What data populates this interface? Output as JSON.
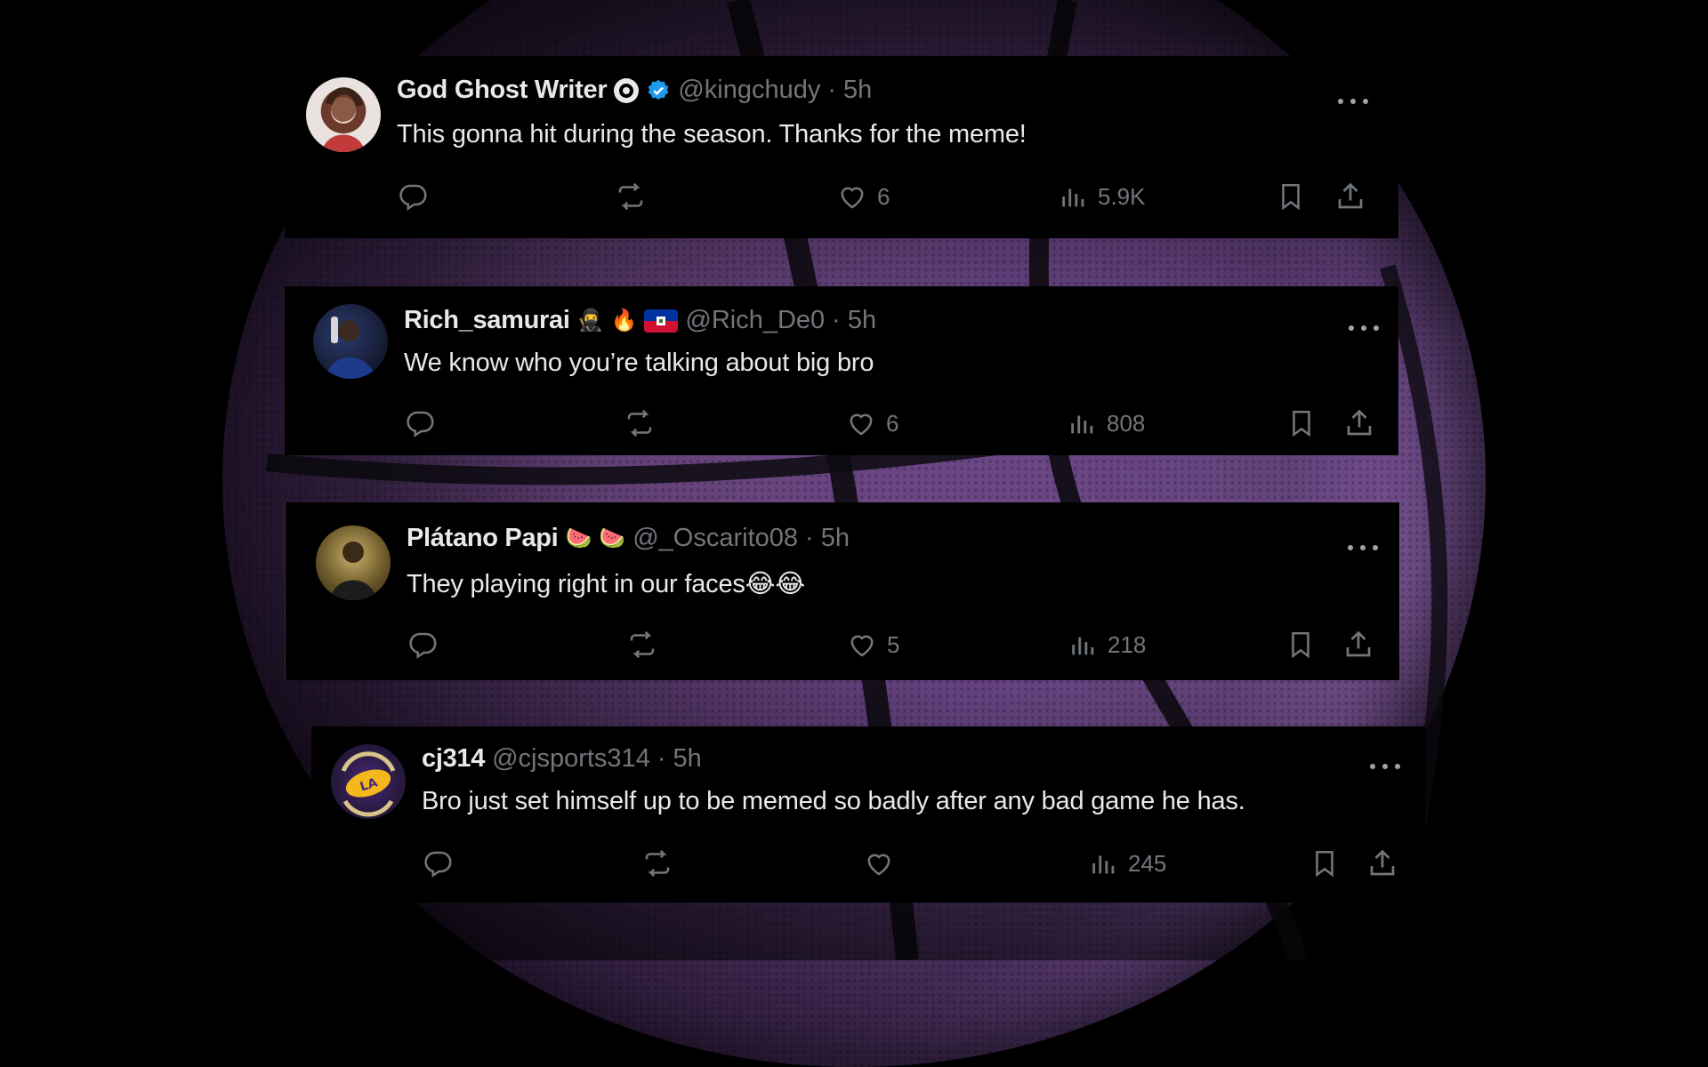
{
  "tweets": [
    {
      "name": "God Ghost Writer",
      "badge_icons": [
        "circle-badge-icon",
        "verified-badge-icon"
      ],
      "handle": "@kingchudy",
      "time": "5h",
      "text": "This gonna hit during the season. Thanks for the meme!",
      "likes": "6",
      "views": "5.9K"
    },
    {
      "name": "Rich_samurai",
      "name_emojis": [
        "🥷",
        "🔥"
      ],
      "flag_icon": "haiti-flag-icon",
      "handle": "@Rich_De0",
      "time": "5h",
      "text": "We know who you’re talking about big bro",
      "likes": "6",
      "views": "808"
    },
    {
      "name": "Plátano Papi",
      "name_emojis": [
        "🍉",
        "🍉"
      ],
      "handle": "@_Oscarito08",
      "time": "5h",
      "text": "They playing right in our faces😂😂",
      "likes": "5",
      "views": "218"
    },
    {
      "name": "cj314",
      "handle": "@cjsports314",
      "time": "5h",
      "text": "Bro just set himself up to be memed so badly after any bad game he has.",
      "likes": "",
      "views": "245"
    }
  ],
  "separator": "·",
  "colors": {
    "card_bg": "#000000",
    "text": "#e7e9ea",
    "muted": "#71767b",
    "verified": "#1d9bf0",
    "ball": "#8a62a6"
  }
}
